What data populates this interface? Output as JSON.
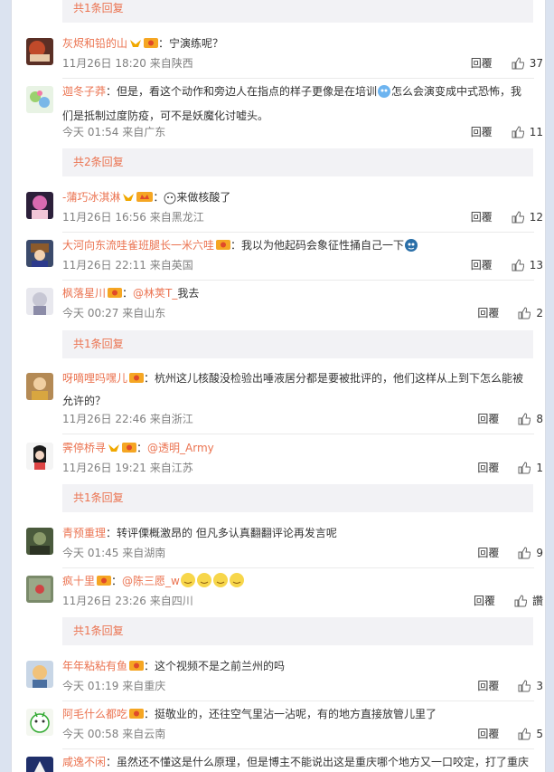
{
  "comments": [
    {
      "user": "灰烬和铅的山",
      "sep": "：",
      "text": "宁演练呢？",
      "meta": "11月26日 18:20 来自陕西",
      "reply": "回覆",
      "likes": "37"
    },
    {
      "user": "迦冬子莽",
      "sep": "：",
      "text": "但是，看这个动作和旁边人在指点的样子更像是在培训",
      "text2": "怎么会演变成中式恐怖，我们是抵制过度防疫，可不是妖魔化讨嘘头。",
      "meta": "今天 01:54 来自广东",
      "reply": "回覆",
      "likes": "11"
    },
    {
      "user": "-蒲巧冰淇淋",
      "sep": "：",
      "text": "来做核酸了",
      "meta": "11月26日 16:56 来自黑龙江",
      "reply": "回覆",
      "likes": "12"
    },
    {
      "user": "大河向东流哇雀班腿长一米六哇",
      "sep": "：",
      "text": "我以为他起码会象征性捅自己一下",
      "meta": "11月26日 22:11 来自英国",
      "reply": "回覆",
      "likes": "13"
    },
    {
      "user": "枫落星川",
      "sep": "：",
      "mention": "@林荚T_",
      "text": "我去",
      "meta": "今天 00:27 来自山东",
      "reply": "回覆",
      "likes": "2"
    },
    {
      "user": "呀嘀哩吗嘿儿",
      "sep": "：",
      "text": "杭州这儿核酸没检验出唾液居分都是要被批评的，他们这样从上到下怎么能被允许的？",
      "meta": "11月26日 22:46 来自浙江",
      "reply": "回覆",
      "likes": "8"
    },
    {
      "user": "霁停桥寻",
      "sep": "：",
      "mention": "@透明_Army",
      "text": "",
      "meta": "11月26日 19:21 来自江苏",
      "reply": "回覆",
      "likes": "1"
    },
    {
      "user": "青预重理",
      "sep": "：",
      "text": "转评傈概激昂的 但凡多认真翻翻评论再发言呢",
      "meta": "今天 01:45 来自湖南",
      "reply": "回覆",
      "likes": "9"
    },
    {
      "user": "疯十里",
      "sep": "：",
      "mention": "@陈三愿_w",
      "text": "",
      "meta": "11月26日 23:26 来自四川",
      "reply": "回覆",
      "likes": "讚"
    },
    {
      "user": "年年粘粘有鱼",
      "sep": "：",
      "text": "这个视频不是之前兰州的吗",
      "meta": "今天 01:19 来自重庆",
      "reply": "回覆",
      "likes": "3"
    },
    {
      "user": "阿毛什么都吃",
      "sep": "：",
      "text": "挺敬业的，还往空气里沾一沾呢，有的地方直接放管儿里了",
      "meta": "今天 00:58 来自云南",
      "reply": "回覆",
      "likes": "5"
    },
    {
      "user": "咸逸不闲",
      "sep": "：",
      "text": "虽然还不懂这是什么原理，但是博主不能说出这是重庆哪个地方又一口咬定，打了重庆",
      "meta": "",
      "reply": "",
      "likes": ""
    }
  ],
  "more_replies": [
    "共1条回复",
    "共2条回复",
    "共1条回复",
    "共1条回复",
    "共1条回复"
  ],
  "colors": {
    "accent": "#eb7350",
    "meta": "#808080",
    "panel": "#f2f2f5",
    "background": "#dbe3f0"
  },
  "icons": [
    "thumbs-up-icon",
    "vip-crown-icon",
    "member-badge-icon",
    "emoji-icon"
  ]
}
